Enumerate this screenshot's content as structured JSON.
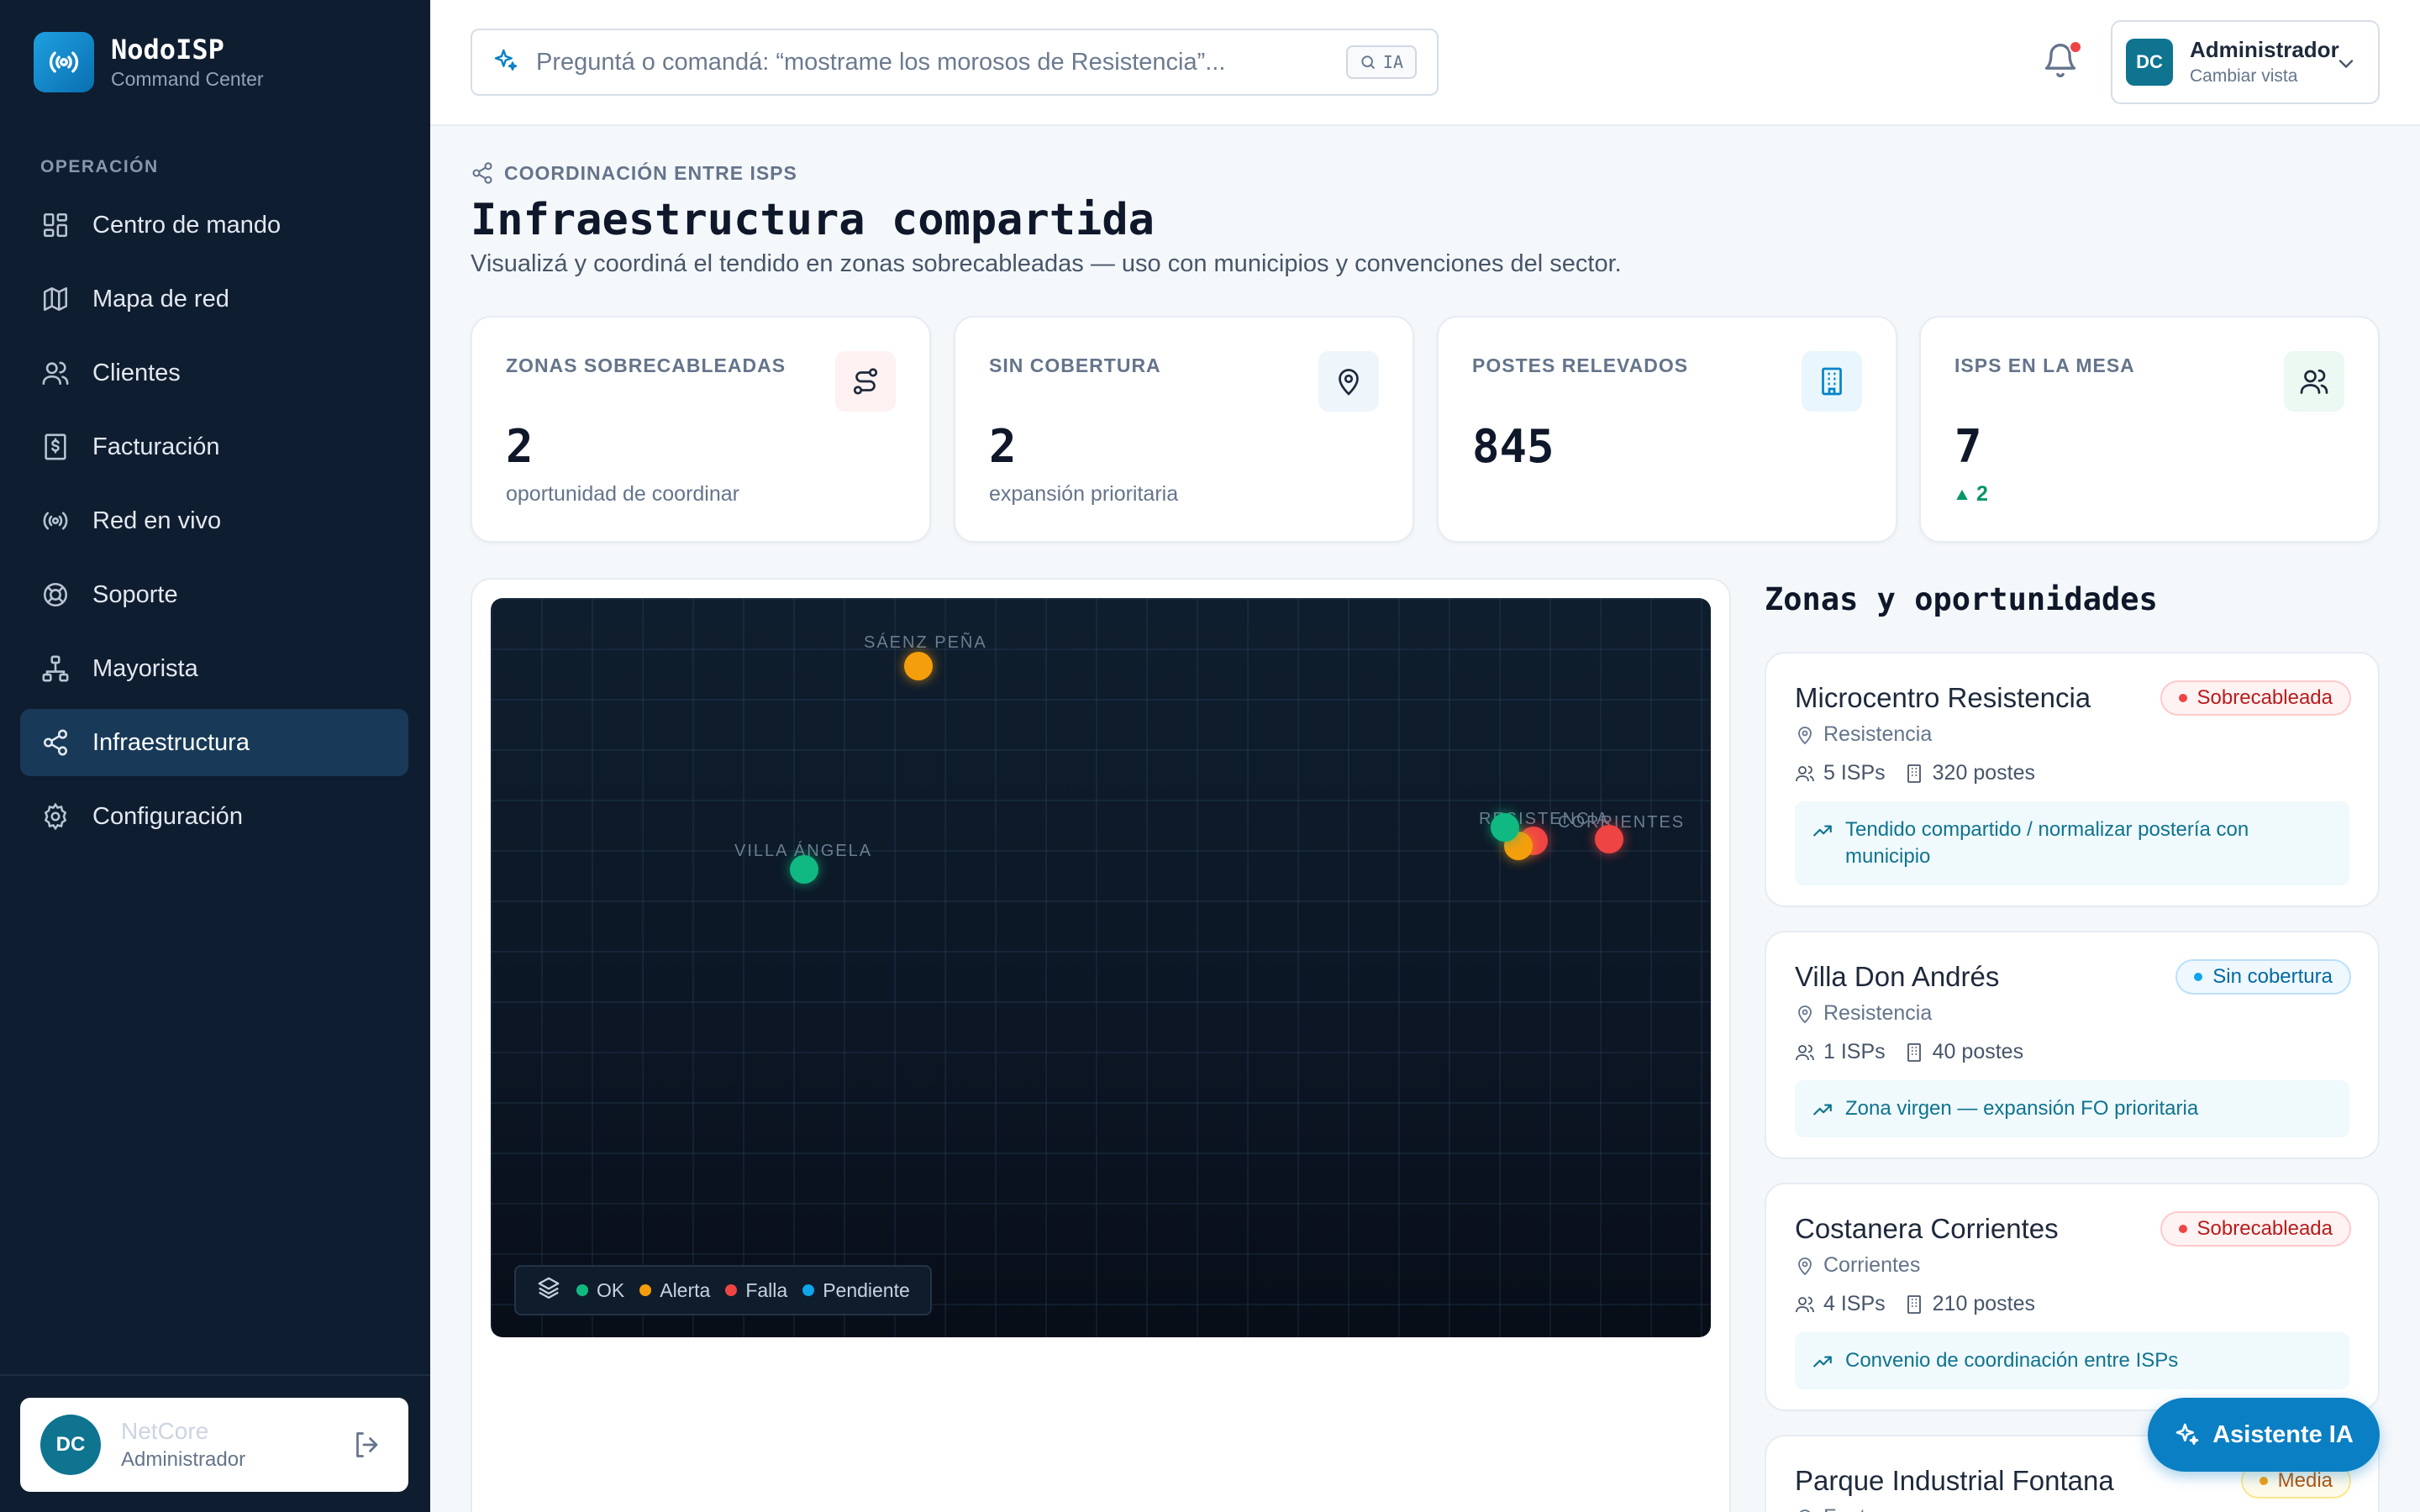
{
  "app": {
    "name": "NodoISP",
    "subtitle": "Command Center"
  },
  "sidebar": {
    "section_label": "OPERACIÓN",
    "items": [
      {
        "label": "Centro de mando",
        "icon": "grid-icon"
      },
      {
        "label": "Mapa de red",
        "icon": "map-icon"
      },
      {
        "label": "Clientes",
        "icon": "users-icon"
      },
      {
        "label": "Facturación",
        "icon": "invoice-icon"
      },
      {
        "label": "Red en vivo",
        "icon": "broadcast-icon"
      },
      {
        "label": "Soporte",
        "icon": "lifebuoy-icon"
      },
      {
        "label": "Mayorista",
        "icon": "network-icon"
      },
      {
        "label": "Infraestructura",
        "icon": "share-icon",
        "active": true
      },
      {
        "label": "Configuración",
        "icon": "gear-icon"
      }
    ],
    "user": {
      "initials": "DC",
      "name": "NetCore",
      "role": "Administrador"
    }
  },
  "topbar": {
    "search_placeholder": "Preguntá o comandá: “mostrame los morosos de Resistencia”...",
    "search_badge": "IA",
    "account": {
      "initials": "DC",
      "name": "Administrador",
      "sub": "Cambiar vista"
    }
  },
  "page": {
    "eyebrow": "COORDINACIÓN ENTRE ISPS",
    "title": "Infraestructura compartida",
    "description": "Visualizá y coordiná el tendido en zonas sobrecableadas — uso con municipios y convenciones del sector."
  },
  "kpis": [
    {
      "label": "ZONAS SOBRECABLEADAS",
      "value": "2",
      "sub": "oportunidad de coordinar",
      "icon": "route-icon",
      "accent": "#dc2626"
    },
    {
      "label": "SIN COBERTURA",
      "value": "2",
      "sub": "expansión prioritaria",
      "icon": "map-pin-icon",
      "accent": "#1e293b"
    },
    {
      "label": "POSTES RELEVADOS",
      "value": "845",
      "sub": "",
      "icon": "building-icon",
      "accent": "#0284c7"
    },
    {
      "label": "ISPS EN LA MESA",
      "value": "7",
      "trend": "2",
      "icon": "users-icon",
      "accent": "#059669"
    }
  ],
  "map": {
    "cities": [
      {
        "name": "SÁENZ PEÑA"
      },
      {
        "name": "VILLA ÁNGELA"
      },
      {
        "name": "RESISTENCIA"
      },
      {
        "name": "CORRIENTES"
      }
    ],
    "legend": [
      {
        "label": "OK",
        "color": "#10b981"
      },
      {
        "label": "Alerta",
        "color": "#f59e0b"
      },
      {
        "label": "Falla",
        "color": "#ef4444"
      },
      {
        "label": "Pendiente",
        "color": "#0ea5e9"
      }
    ]
  },
  "zones": {
    "title": "Zonas y oportunidades",
    "items": [
      {
        "name": "Microcentro Resistencia",
        "location": "Resistencia",
        "isps": "5 ISPs",
        "poles": "320 postes",
        "badge": "Sobrecableada",
        "note": "Tendido compartido / normalizar postería con municipio"
      },
      {
        "name": "Villa Don Andrés",
        "location": "Resistencia",
        "isps": "1 ISPs",
        "poles": "40 postes",
        "badge": "Sin cobertura",
        "note": "Zona virgen — expansión FO prioritaria"
      },
      {
        "name": "Costanera Corrientes",
        "location": "Corrientes",
        "isps": "4 ISPs",
        "poles": "210 postes",
        "badge": "Sobrecableada",
        "note": "Convenio de coordinación entre ISPs"
      },
      {
        "name": "Parque Industrial Fontana",
        "location": "Fontana",
        "badge": "Media"
      }
    ]
  },
  "fab_label": "Asistente IA"
}
